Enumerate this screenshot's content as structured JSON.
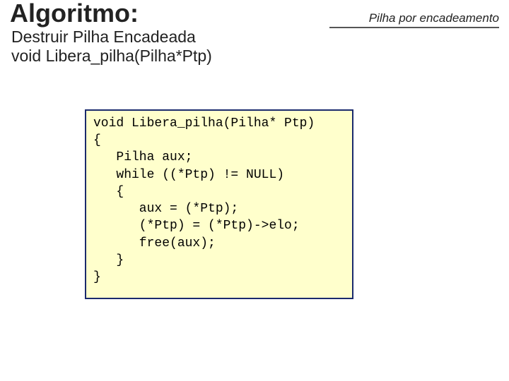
{
  "header": {
    "topright_label": "Pilha por encadeamento",
    "title": "Algoritmo:",
    "subtitle_line1": "Destruir Pilha Encadeada",
    "subtitle_line2": "void Libera_pilha(Pilha*Ptp)"
  },
  "code": {
    "line0": "void Libera_pilha(Pilha* Ptp)",
    "line1": "{",
    "line2": "   Pilha aux;",
    "line3": "   while ((*Ptp) != NULL)",
    "line4": "   {",
    "line5": "      aux = (*Ptp);",
    "line6": "      (*Ptp) = (*Ptp)->elo;",
    "line7": "      free(aux);",
    "line8": "   }",
    "line9": "}"
  }
}
